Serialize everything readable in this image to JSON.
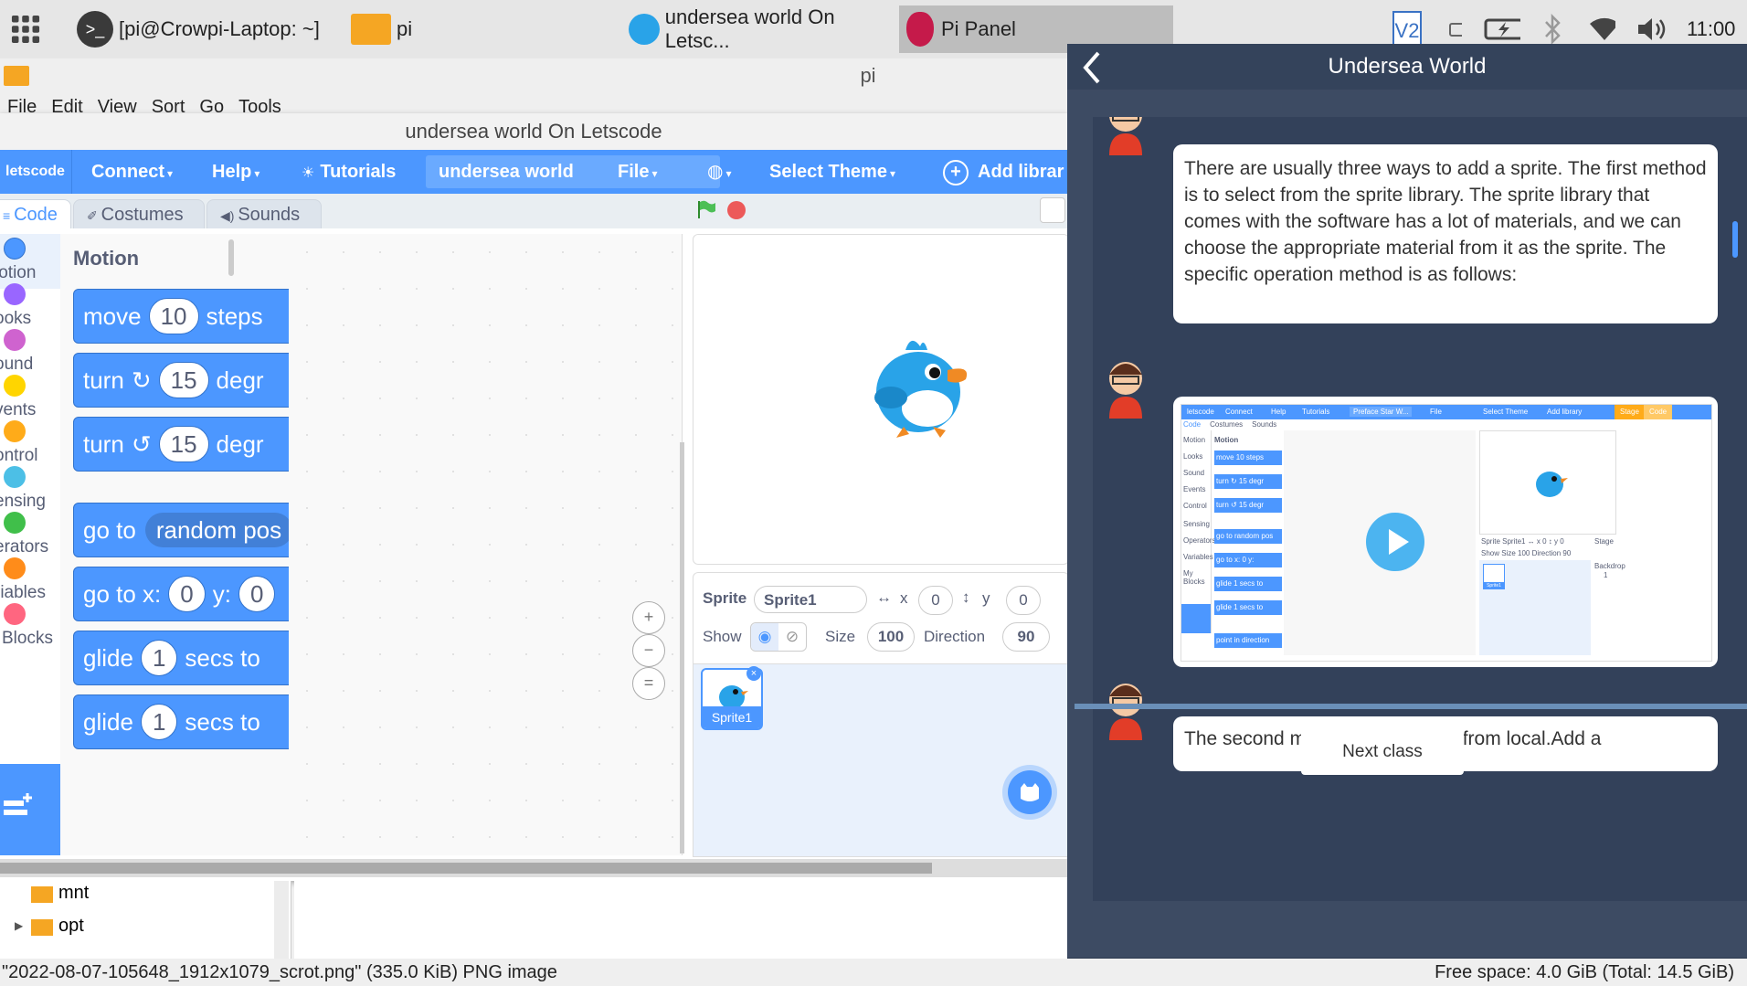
{
  "taskbar": {
    "terminal_label": "[pi@Crowpi-Laptop: ~]",
    "folder_label": "pi",
    "browser_label": "undersea world On Letsc...",
    "pipanel_label": "Pi Panel",
    "clock": "11:00",
    "vnc_label": "V2"
  },
  "file_manager": {
    "title": "pi",
    "menu": [
      "File",
      "Edit",
      "View",
      "Sort",
      "Go",
      "Tools"
    ],
    "tree": [
      "mnt",
      "opt"
    ],
    "status_left": "\"2022-08-07-105648_1912x1079_scrot.png\" (335.0 KiB) PNG image",
    "status_right": "Free space: 4.0 GiB (Total: 14.5 GiB)"
  },
  "letscode": {
    "window_title": "undersea world On Letscode",
    "logo": "letscode",
    "menu": {
      "connect": "Connect",
      "help": "Help",
      "tutorials": "Tutorials",
      "project": "undersea world",
      "file": "File",
      "theme": "Select Theme",
      "add_library": "Add librar"
    },
    "tabs": {
      "code": "Code",
      "costumes": "Costumes",
      "sounds": "Sounds"
    },
    "categories": [
      {
        "label": "lotion",
        "color": "#4c97ff"
      },
      {
        "label": "ooks",
        "color": "#9966ff"
      },
      {
        "label": "ound",
        "color": "#cf63cf"
      },
      {
        "label": "vents",
        "color": "#ffd500"
      },
      {
        "label": "ontrol",
        "color": "#ffab19"
      },
      {
        "label": "ensing",
        "color": "#4cbfe6"
      },
      {
        "label": "erators",
        "color": "#40bf4a"
      },
      {
        "label": "riables",
        "color": "#ff8c1a"
      },
      {
        "label": "Blocks",
        "color": "#ff6680"
      }
    ],
    "palette_title": "Motion",
    "blocks": {
      "move_a": "move",
      "move_val": "10",
      "move_b": "steps",
      "turn_r_a": "turn",
      "turn_r_val": "15",
      "turn_r_b": "degr",
      "turn_l_a": "turn",
      "turn_l_val": "15",
      "turn_l_b": "degr",
      "goto_a": "go to",
      "goto_val": "random pos",
      "gotoxy_a": "go to x:",
      "gotoxy_x": "0",
      "gotoxy_b": "y:",
      "gotoxy_y": "0",
      "glide1_a": "glide",
      "glide1_val": "1",
      "glide1_b": "secs to",
      "glide2_a": "glide",
      "glide2_val": "1",
      "glide2_b": "secs to"
    },
    "zoom": {
      "in": "+",
      "out": "−",
      "reset": "="
    },
    "sprite": {
      "label_sprite": "Sprite",
      "name": "Sprite1",
      "label_x": "x",
      "x": "0",
      "label_y": "y",
      "y": "0",
      "label_show": "Show",
      "label_size": "Size",
      "size": "100",
      "label_direction": "Direction",
      "direction": "90",
      "thumb_label": "Sprite1"
    }
  },
  "pipanel": {
    "title": "Undersea World",
    "text1": "There are usually three ways to add a sprite. The first method is to select from the sprite library. The sprite library that comes with the software has a lot of materials, and we can choose the appropriate material from it as the sprite. The specific operation method is as follows:",
    "text2": "The second method is to upload from local.Add a",
    "next_button": "Next class",
    "video": {
      "logo": "letscode",
      "connect": "Connect",
      "help": "Help",
      "tutorials": "Tutorials",
      "project": "Preface Star W...",
      "file": "File",
      "theme": "Select Theme",
      "add_library": "Add library",
      "stage_btn": "Stage",
      "code_btn": "Code",
      "tab_code": "Code",
      "tab_costumes": "Costumes",
      "tab_sounds": "Sounds",
      "palette_title": "Motion",
      "categories": [
        "Motion",
        "Looks",
        "Sound",
        "Events",
        "Control",
        "Sensing",
        "Operators",
        "Variables",
        "My Blocks"
      ],
      "blocks": [
        "move 10 steps",
        "turn ↻ 15 degr",
        "turn ↺ 15 degr",
        "go to random pos",
        "go to x: 0 y:",
        "glide 1 secs to",
        "glide 1 secs to",
        "point in direction"
      ],
      "sprite_row": "Sprite  Sprite1   ↔ x  0   ↕ y  0",
      "show_row": "Show       Size  100   Direction  90",
      "stage_label": "Stage",
      "backdrops": "Backdrop",
      "backdrops_count": "1",
      "thumb": "Sprite1"
    }
  }
}
